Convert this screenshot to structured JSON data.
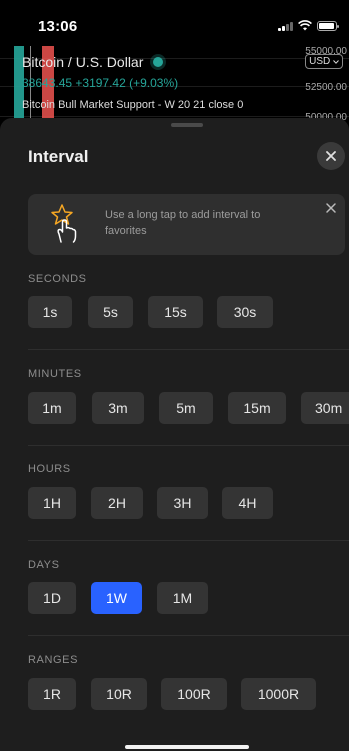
{
  "status_bar": {
    "time": "13:06"
  },
  "chart": {
    "symbol": "Bitcoin / U.S. Dollar",
    "price_line": "38643.45 +3197.42 (+9.03%)",
    "indicator": "Bitcoin Bull Market Support - W 20 21 close 0",
    "currency": "USD",
    "price_labels": [
      "55000.00",
      "52500.00",
      "50000.00"
    ],
    "colors": {
      "up": "#26a69a",
      "down": "#ef5350"
    }
  },
  "sheet": {
    "title": "Interval",
    "tip": {
      "icon": "hand-tap-star-icon",
      "text": "Use a long tap to add interval to favorites"
    },
    "accent_color": "#2962ff",
    "sections": [
      {
        "label": "SECONDS",
        "options": [
          "1s",
          "5s",
          "15s",
          "30s"
        ]
      },
      {
        "label": "MINUTES",
        "options": [
          "1m",
          "3m",
          "5m",
          "15m",
          "30m"
        ]
      },
      {
        "label": "HOURS",
        "options": [
          "1H",
          "2H",
          "3H",
          "4H"
        ]
      },
      {
        "label": "DAYS",
        "options": [
          "1D",
          "1W",
          "1M"
        ],
        "selected": "1W"
      },
      {
        "label": "RANGES",
        "options": [
          "1R",
          "10R",
          "100R",
          "1000R"
        ]
      }
    ]
  }
}
